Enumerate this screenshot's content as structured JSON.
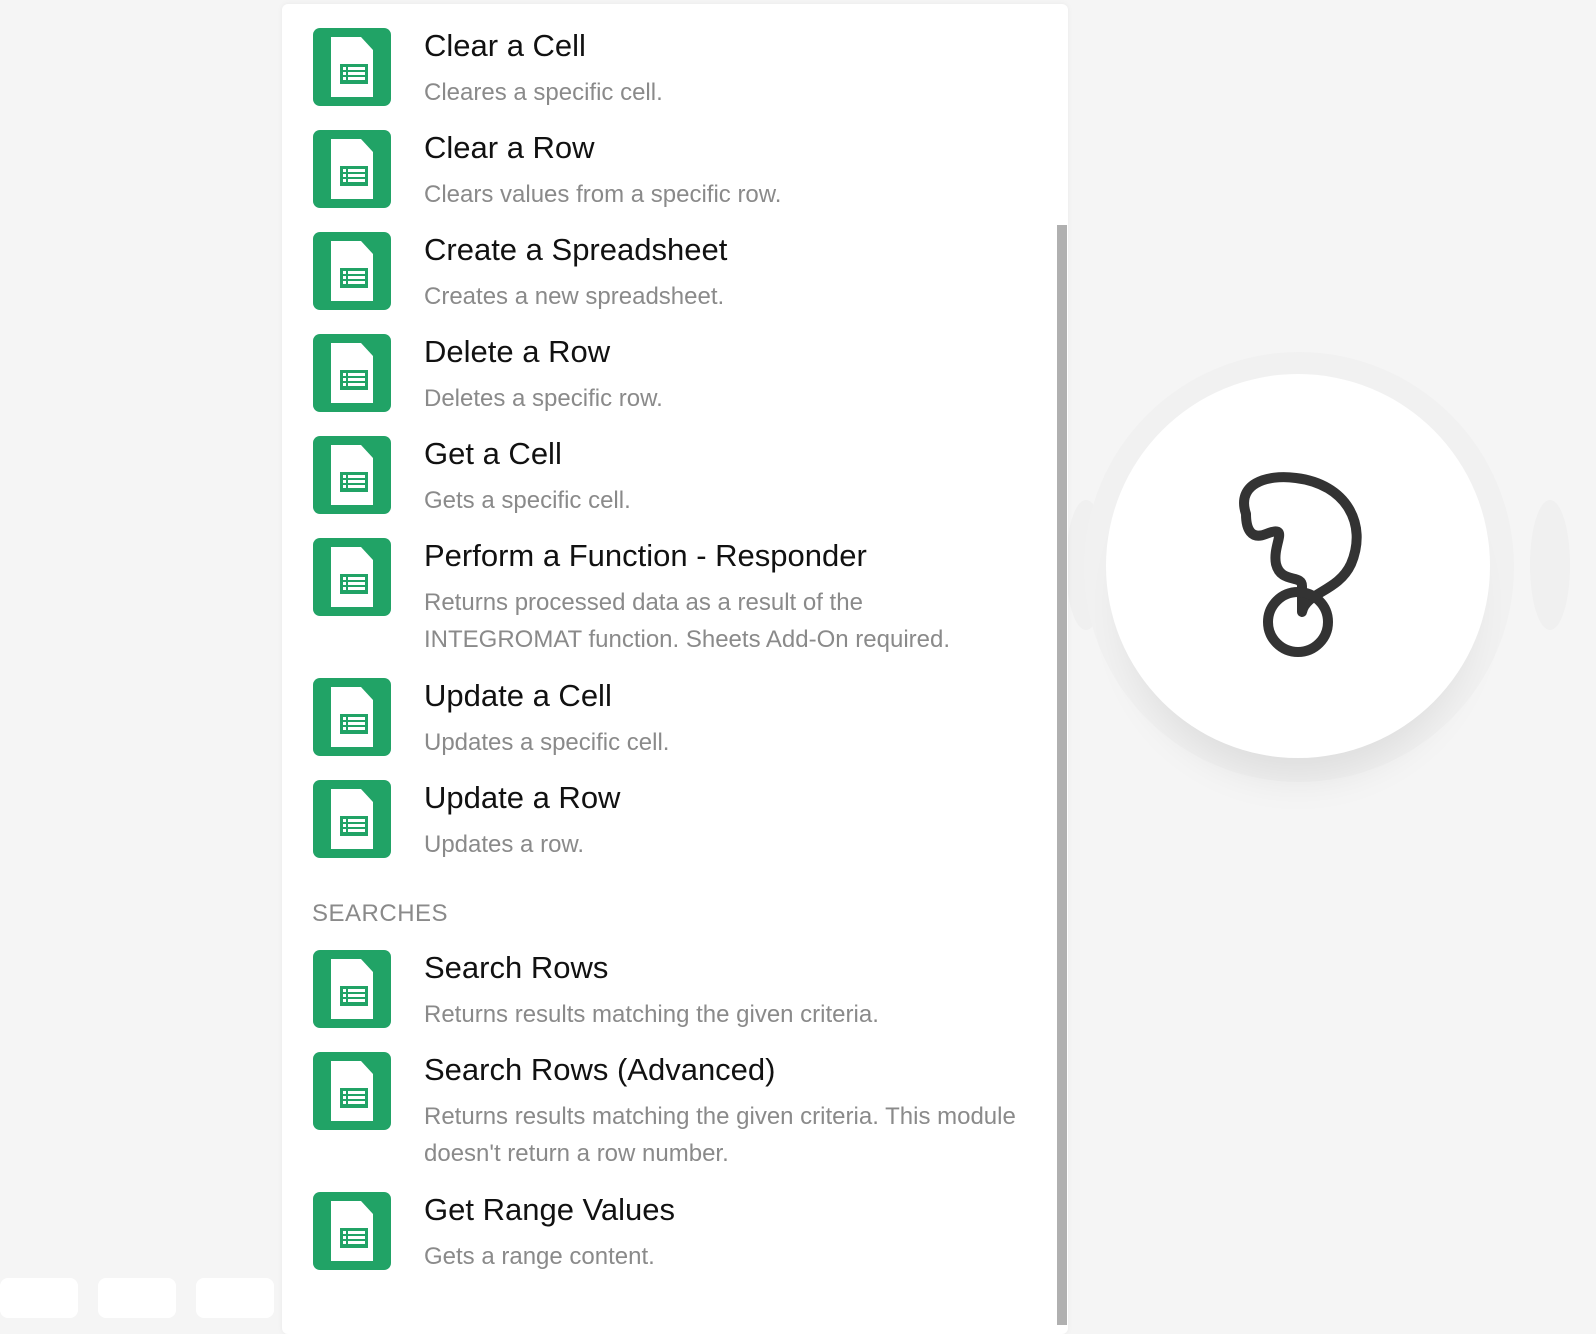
{
  "actions": [
    {
      "title": "Clear a Cell",
      "desc": "Cleares a specific cell."
    },
    {
      "title": "Clear a Row",
      "desc": "Clears values from a specific row."
    },
    {
      "title": "Create a Spreadsheet",
      "desc": "Creates a new spreadsheet."
    },
    {
      "title": "Delete a Row",
      "desc": "Deletes a specific row."
    },
    {
      "title": "Get a Cell",
      "desc": "Gets a specific cell."
    },
    {
      "title": "Perform a Function - Responder",
      "desc": "Returns processed data as a result of the INTEGROMAT function. Sheets Add-On required."
    },
    {
      "title": "Update a Cell",
      "desc": "Updates a specific cell."
    },
    {
      "title": "Update a Row",
      "desc": "Updates a row."
    }
  ],
  "searches_label": "SEARCHES",
  "searches": [
    {
      "title": "Search Rows",
      "desc": "Returns results matching the given criteria."
    },
    {
      "title": "Search Rows (Advanced)",
      "desc": "Returns results matching the given criteria. This module doesn't return a row number."
    },
    {
      "title": "Get Range Values",
      "desc": "Gets a range content."
    }
  ],
  "colors": {
    "accent": "#21a366"
  }
}
